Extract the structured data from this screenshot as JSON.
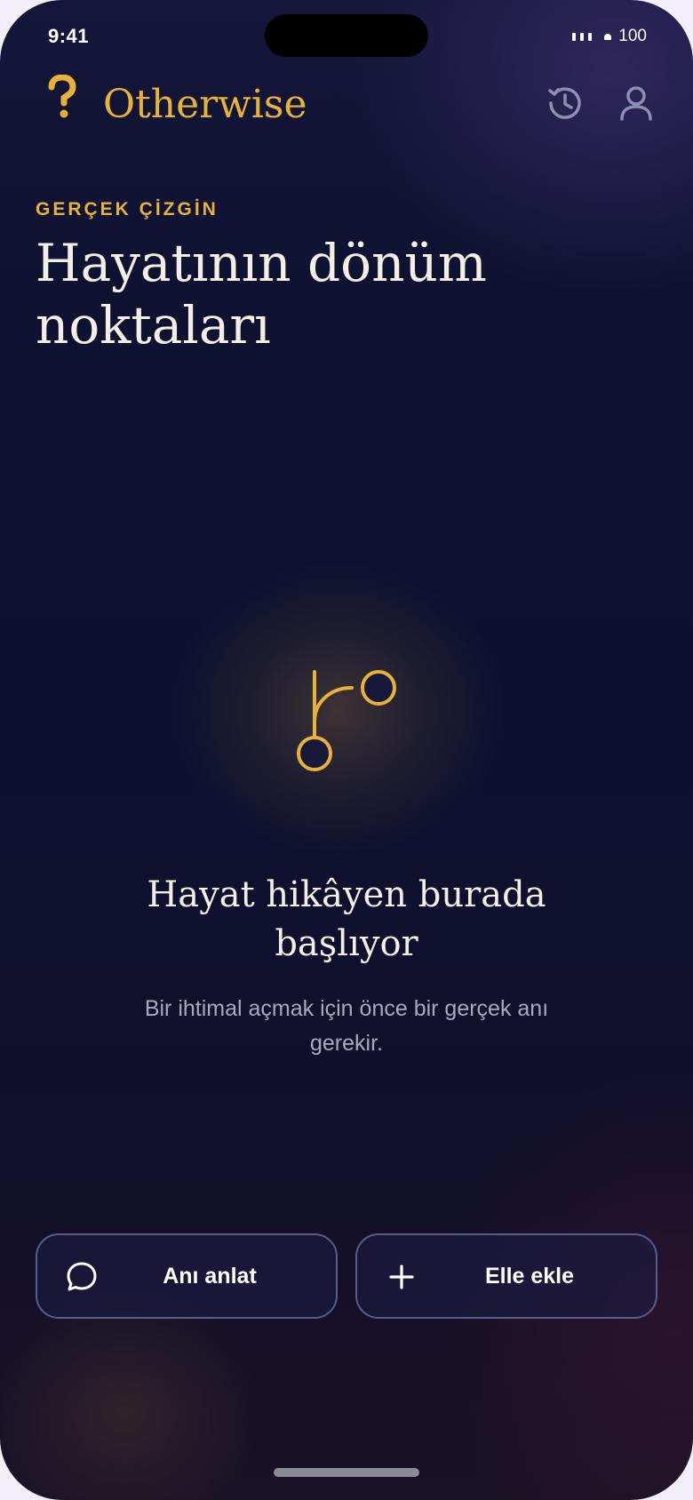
{
  "status_bar": {
    "time": "9:41",
    "battery": "100"
  },
  "header": {
    "app_name": "Otherwise",
    "logo_icon": "question-mark-icon",
    "history_icon": "history-icon",
    "profile_icon": "user-icon"
  },
  "section": {
    "eyebrow": "GERÇEK ÇİZGİN",
    "title": "Hayatının dönüm noktaları"
  },
  "empty_state": {
    "icon": "branch-icon",
    "title": "Hayat hikâyen burada başlıyor",
    "subtitle": "Bir ihtimal açmak için önce bir gerçek anı gerekir."
  },
  "actions": {
    "tell_label": "Anı anlat",
    "tell_icon": "chat-bubble-icon",
    "add_label": "Elle ekle",
    "add_icon": "plus-icon"
  },
  "colors": {
    "accent": "#e8b238",
    "background": "#0e1230",
    "text": "#f3eee6",
    "muted": "#a9a8c4"
  }
}
